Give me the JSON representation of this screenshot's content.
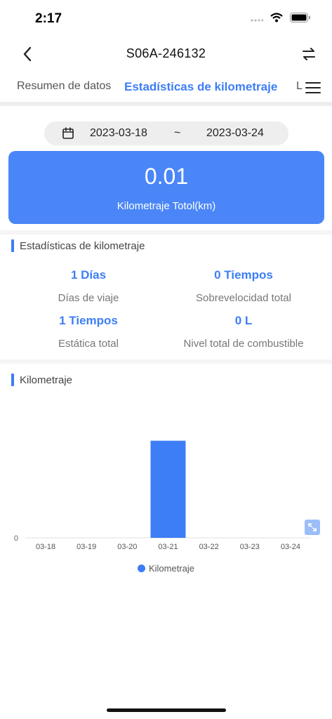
{
  "status_bar": {
    "time": "2:17"
  },
  "nav": {
    "title": "S06A-246132"
  },
  "tabs": [
    {
      "label": "Resumen de datos"
    },
    {
      "label": "Estadísticas de kilometraje"
    },
    {
      "label": "L"
    }
  ],
  "date_range": {
    "start": "2023-03-18",
    "separator": "~",
    "end": "2023-03-24"
  },
  "summary": {
    "value": "0.01",
    "label": "Kilometraje Totol(km)"
  },
  "stats_section": {
    "title": "Estadísticas de kilometraje",
    "items": [
      {
        "value": "1 Días",
        "label": "Días de viaje"
      },
      {
        "value": "0 Tiempos",
        "label": "Sobrevelocidad total"
      },
      {
        "value": "1 Tiempos",
        "label": "Estática total"
      },
      {
        "value": "0 L",
        "label": "Nivel total de combustible"
      }
    ]
  },
  "chart_section": {
    "title": "Kilometraje"
  },
  "chart_data": {
    "type": "bar",
    "categories": [
      "03-18",
      "03-19",
      "03-20",
      "03-21",
      "03-22",
      "03-23",
      "03-24"
    ],
    "series": [
      {
        "name": "Kilometraje",
        "values": [
          0,
          0,
          0,
          0.01,
          0,
          0,
          0
        ]
      }
    ],
    "y_ticks": [
      "0"
    ],
    "ylim": [
      0,
      0.012
    ],
    "grid": false,
    "legend_position": "bottom",
    "color": "#3d7ef6"
  },
  "colors": {
    "accent": "#3d7ef6",
    "card": "#4a86f7"
  }
}
